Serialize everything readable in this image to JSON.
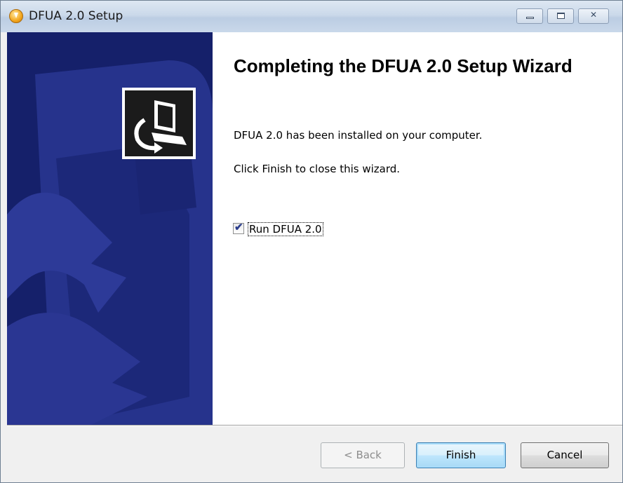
{
  "window": {
    "title": "DFUA 2.0 Setup",
    "icon": "setup-shield-icon"
  },
  "title_buttons": {
    "minimize": "minimize-icon",
    "maximize": "maximize-icon",
    "close": "✕"
  },
  "content": {
    "heading": "Completing the DFUA 2.0 Setup Wizard",
    "line1": "DFUA 2.0 has been installed on your computer.",
    "line2": "Click Finish to close this wizard.",
    "run_checkbox": {
      "label": "Run DFUA 2.0",
      "checked": true,
      "mark": "✔"
    }
  },
  "buttons": {
    "back": {
      "label": "< Back",
      "enabled": false
    },
    "finish": {
      "label": "Finish",
      "enabled": true
    },
    "cancel": {
      "label": "Cancel",
      "enabled": true
    }
  },
  "colors": {
    "banner": "#15206a",
    "accent": "#3c7fb1"
  }
}
